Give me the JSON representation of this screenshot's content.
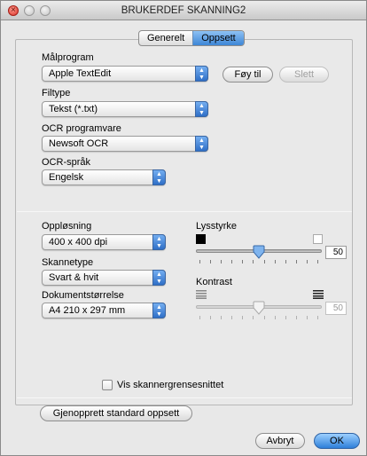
{
  "window": {
    "title": "BRUKERDEF SKANNING2"
  },
  "tabs": [
    {
      "label": "Generelt",
      "active": false
    },
    {
      "label": "Oppsett",
      "active": true
    }
  ],
  "target_app": {
    "label": "Målprogram",
    "value": "Apple TextEdit",
    "add_label": "Føy til",
    "delete_label": "Slett"
  },
  "file_type": {
    "label": "Filtype",
    "value": "Tekst (*.txt)"
  },
  "ocr_software": {
    "label": "OCR programvare",
    "value": "Newsoft OCR"
  },
  "ocr_language": {
    "label": "OCR-språk",
    "value": "Engelsk"
  },
  "resolution": {
    "label": "Oppløsning",
    "value": "400 x 400 dpi"
  },
  "scan_type": {
    "label": "Skannetype",
    "value": "Svart & hvit"
  },
  "doc_size": {
    "label": "Dokumentstørrelse",
    "value": "A4  210 x 297 mm"
  },
  "brightness": {
    "label": "Lysstyrke",
    "value": "50",
    "level": 0.5
  },
  "contrast": {
    "label": "Kontrast",
    "value": "50",
    "level": 0.5,
    "enabled": false
  },
  "show_interface": {
    "label": "Vis skannergrensesnittet",
    "checked": false
  },
  "restore_label": "Gjenopprett standard oppsett",
  "cancel_label": "Avbryt",
  "ok_label": "OK",
  "colors": {
    "accent": "#3d86d6",
    "close_button": "#d9322a"
  }
}
